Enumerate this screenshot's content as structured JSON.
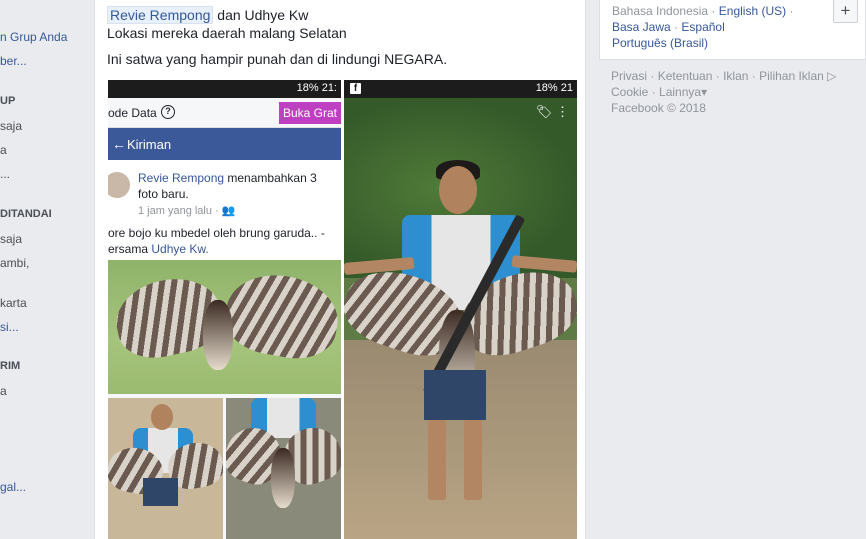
{
  "sidebar": {
    "group_link": "n Grup Anda",
    "more_1": "ber...",
    "section_1": "UP",
    "item_1": "saja",
    "item_2": "a",
    "item_3": "...",
    "section_2": "DITANDAI",
    "item_4": "saja",
    "item_5": "ambi,",
    "item_6": "karta",
    "more_2": "si...",
    "section_3": "RIM",
    "item_7": "a",
    "more_3": "gal..."
  },
  "post": {
    "author": "Revie Rempong",
    "with_text": "dan Udhye Kw",
    "line_2": "Lokasi mereka daerah malang Selatan",
    "line_3": "Ini satwa yang hampir punah dan di lindungi NEGARA."
  },
  "screenshot_left": {
    "status": "18% 21:",
    "topbar_label": "ode Data",
    "topbar_help": "?",
    "buka_button": "Buka Grat",
    "bluebar_label": "Kiriman",
    "inner_author": "Revie Rempong",
    "inner_action": "menambahkan 3 foto baru.",
    "inner_time": "1 jam yang lalu · ",
    "inner_caption_1": "ore bojo ku mbedel oleh brung garuda.. -",
    "inner_caption_2": "ersama",
    "inner_caption_tag": "Udhye Kw."
  },
  "screenshot_right": {
    "status": "18% 21",
    "fb_icon": "f"
  },
  "right_column": {
    "languages_row1": [
      "Bahasa Indonesia",
      "English (US)"
    ],
    "languages_row2": [
      "Basa Jawa",
      "Español"
    ],
    "languages_row3": [
      "Português (Brasil)"
    ],
    "plus_label": "+"
  },
  "footer": {
    "links_row1": [
      "Privasi",
      "Ketentuan",
      "Iklan",
      "Pilihan Iklan"
    ],
    "links_row2": [
      "Cookie",
      "Lainnya"
    ],
    "copyright": "Facebook © 2018"
  }
}
